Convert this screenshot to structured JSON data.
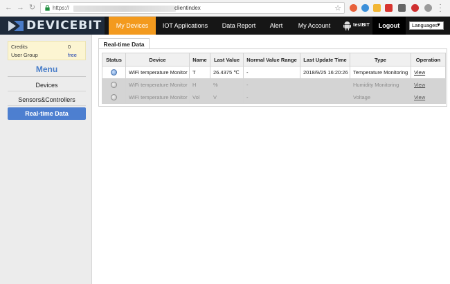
{
  "browser": {
    "url_scheme": "https://",
    "url_tail": "clientindex"
  },
  "header": {
    "logo_text": "DEVICEBIT",
    "tabs": [
      {
        "label": "My Devices",
        "active": true
      },
      {
        "label": "IOT Applications",
        "active": false
      },
      {
        "label": "Data Report",
        "active": false
      },
      {
        "label": "Alert",
        "active": false
      },
      {
        "label": "My Account",
        "active": false
      }
    ],
    "username": "testBIT",
    "logout_label": "Logout",
    "language_label": "Languages",
    "accent_color": "#f39a1e"
  },
  "sidebar": {
    "credits_label": "Credits",
    "credits_value": "0",
    "usergroup_label": "User Group",
    "usergroup_value": "free",
    "menu_title": "Menu",
    "items": [
      {
        "label": "Devices",
        "active": false
      },
      {
        "label": "Sensors&Controllers",
        "active": false
      },
      {
        "label": "Real-time Data",
        "active": true
      }
    ]
  },
  "main": {
    "panel_title": "Real-time Data",
    "columns": [
      "Status",
      "Device",
      "Name",
      "Last Value",
      "Normal Value Range",
      "Last Update Time",
      "Type",
      "Operation"
    ],
    "rows": [
      {
        "status": "online",
        "device": "WiFi temperature Monitor",
        "name": "T",
        "last_value": "26.4375 ℃",
        "range": "-",
        "updated": "2018/9/25 16:20:26",
        "type": "Temperature Monitoring",
        "operation": "View"
      },
      {
        "status": "offline",
        "device": "WiFi temperature Monitor",
        "name": "H",
        "last_value": "%",
        "range": "-",
        "updated": "",
        "type": "Humidity Monitoring",
        "operation": "View"
      },
      {
        "status": "offline",
        "device": "WiFi temperature Monitor",
        "name": "Vol",
        "last_value": "V",
        "range": "-",
        "updated": "",
        "type": "Voltage",
        "operation": "View"
      }
    ]
  }
}
